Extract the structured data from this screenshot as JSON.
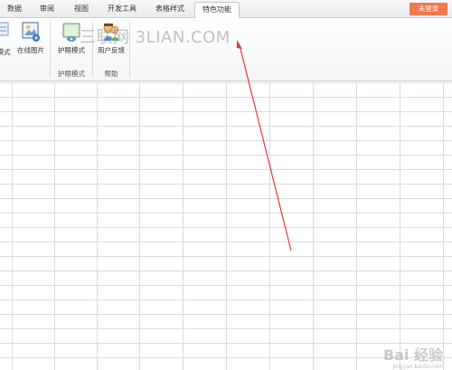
{
  "menu": {
    "tabs": [
      {
        "label": "数据"
      },
      {
        "label": "审阅"
      },
      {
        "label": "视图"
      },
      {
        "label": "开发工具"
      },
      {
        "label": "表格样式"
      },
      {
        "label": "特色功能"
      }
    ],
    "login_label": "未登录"
  },
  "ribbon": {
    "left_cut_label": "模式",
    "online_image_label": "在线图片",
    "eye_mode_label": "护眼模式",
    "feedback_label": "用户反馈",
    "groups": {
      "eye_mode_group": "护眼模式",
      "help_group": "帮助"
    }
  },
  "watermark": {
    "text": "三联网 3LIAN.COM"
  },
  "baidu_watermark": {
    "logo": "Bai 经验",
    "sub": "jingyan.baidu.com"
  },
  "colors": {
    "login_button": "#ef7a4e",
    "annotation_arrow": "#e53935",
    "grid_line": "#d8dbde"
  }
}
